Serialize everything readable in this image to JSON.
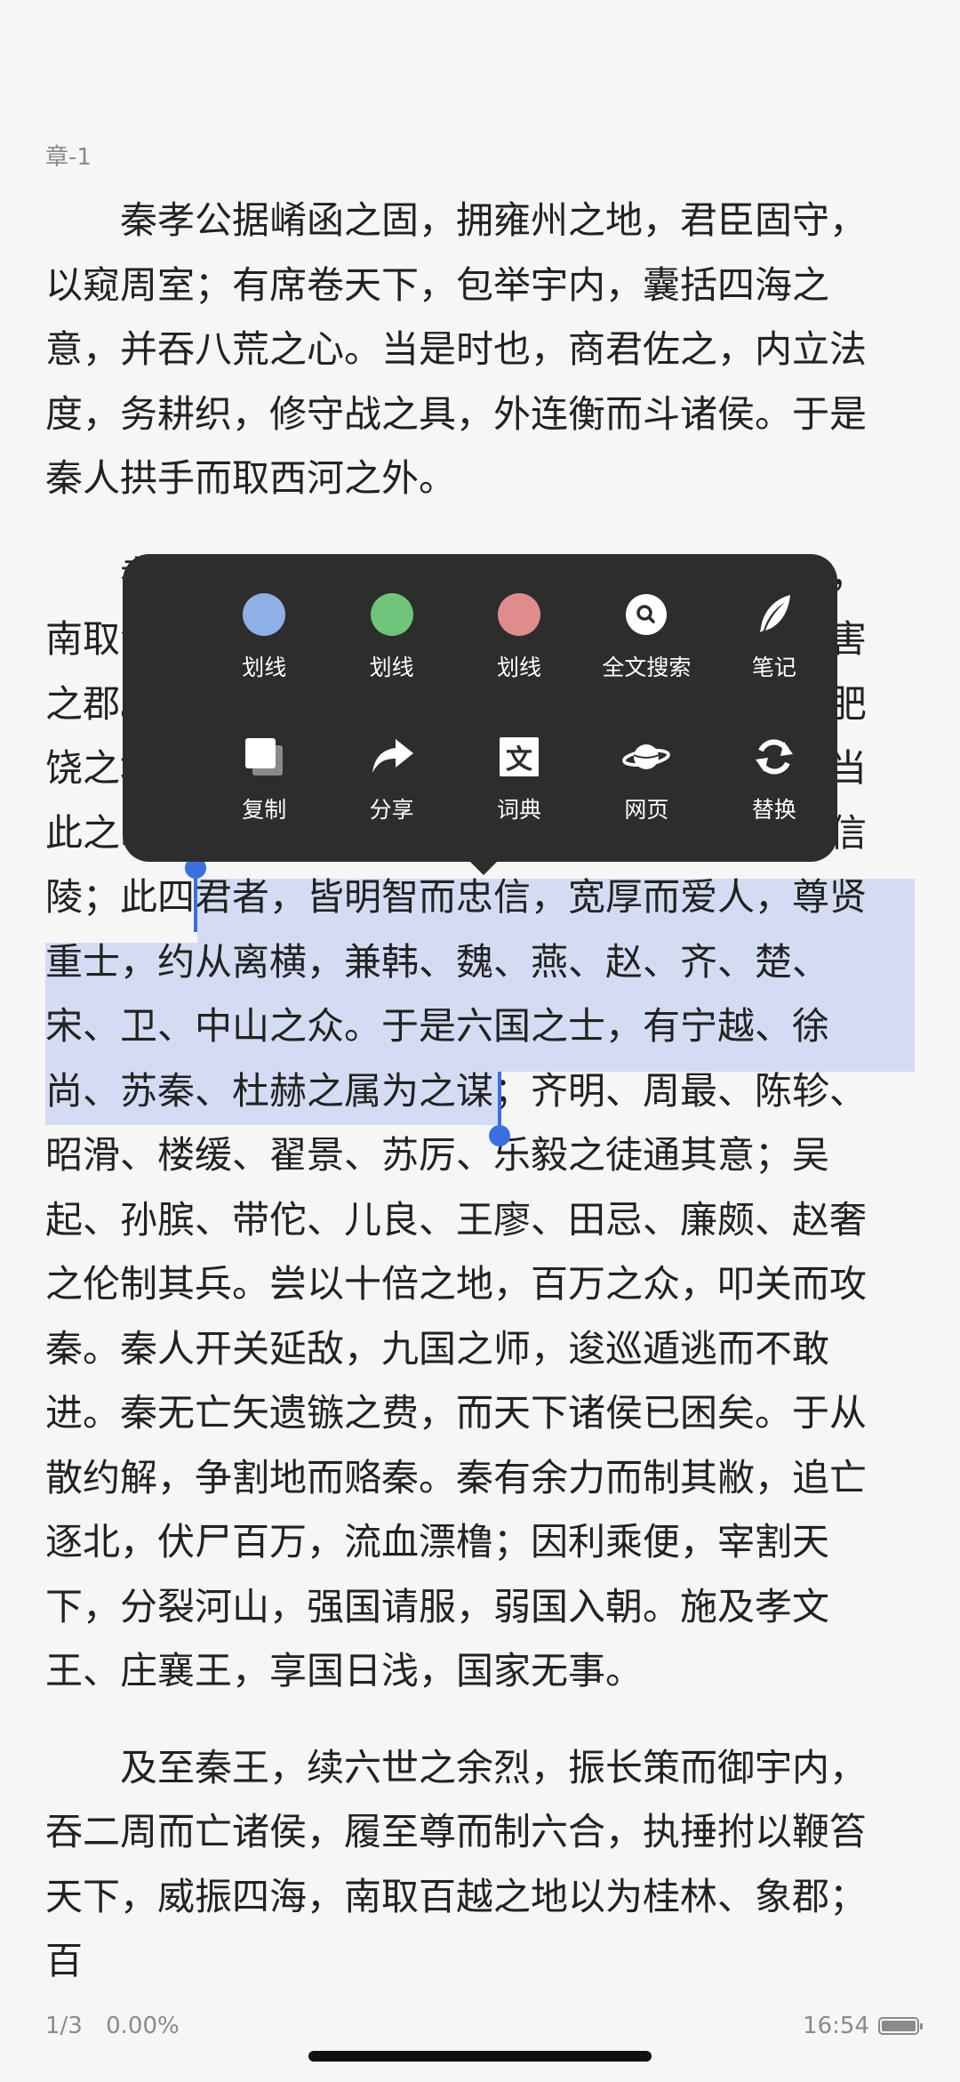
{
  "chapter": "章-1",
  "paragraphs": [
    "秦孝公据崤函之固，拥雍州之地，君臣固守，以窥周室；有席卷天下，包举宇内，囊括四海之意，并吞八荒之心。当是时也，商君佐之，内立法度，务耕织，修守战之具，外连衡而斗诸侯。于是秦人拱手而取西河之外。",
    "孝公既没，惠文、武、昭襄蒙故业，因遗策，南取汉中，西举巴、蜀，东割膏腴之地，北收要害之郡。诸侯恐惧，会盟而谋弱秦，不爱珍器重宝肥饶之地，以致天下之士，合从缔交，相与为一。当此之时，齐有孟尝，赵有平原，楚有春申，魏有信陵；此四君者，皆明智而忠信，宽厚而爱人，尊贤重士，约从离横，兼韩、魏、燕、赵、齐、楚、宋、卫、中山之众。于是六国之士，有宁越、徐尚、苏秦、杜赫之属为之谋；齐明、周最、陈轸、昭滑、楼缓、翟景、苏厉、乐毅之徒通其意；吴起、孙膑、带佗、儿良、王廖、田忌、廉颇、赵奢之伦制其兵。尝以十倍之地，百万之众，叩关而攻秦。秦人开关延敌，九国之师，逡巡遁逃而不敢进。秦无亡矢遗镞之费，而天下诸侯已困矣。于从散约解，争割地而赂秦。秦有余力而制其敝，追亡逐北，伏尸百万，流血漂橹；因利乘便，宰割天下，分裂河山，强国请服，弱国入朝。施及孝文王、庄襄王，享国日浅，国家无事。",
    "及至秦王，续六世之余烈，振长策而御宇内，吞二周而亡诸侯，履至尊而制六合，执捶拊以鞭笞天下，威振四海，南取百越之地以为桂林、象郡；百"
  ],
  "selected_text": "君者，皆明智而忠信，宽厚而爱人，尊贤重士，约从离横，兼韩、魏、燕、赵、齐、楚、宋、卫、中山之众。于是六国之士，有宁越、徐尚、苏秦、杜赫之属为之谋",
  "menu": {
    "row1": [
      {
        "icon": "blue-highlight-dot",
        "label": "划线",
        "color": "#8fb0e6"
      },
      {
        "icon": "green-highlight-dot",
        "label": "划线",
        "color": "#6fc47a"
      },
      {
        "icon": "red-highlight-dot",
        "label": "划线",
        "color": "#e08c8c"
      },
      {
        "icon": "search-icon",
        "label": "全文搜索"
      },
      {
        "icon": "feather-icon",
        "label": "笔记"
      }
    ],
    "row2": [
      {
        "icon": "copy-icon",
        "label": "复制"
      },
      {
        "icon": "share-icon",
        "label": "分享"
      },
      {
        "icon": "dictionary-icon",
        "label": "词典",
        "glyph": "文"
      },
      {
        "icon": "planet-icon",
        "label": "网页"
      },
      {
        "icon": "refresh-icon",
        "label": "替换"
      }
    ]
  },
  "status": {
    "page": "1/3",
    "progress": "0.00%",
    "time": "16:54"
  },
  "colors": {
    "selection": "#d3dcf2",
    "cursor": "#3c6fe0",
    "popup": "#2d2d2d"
  }
}
